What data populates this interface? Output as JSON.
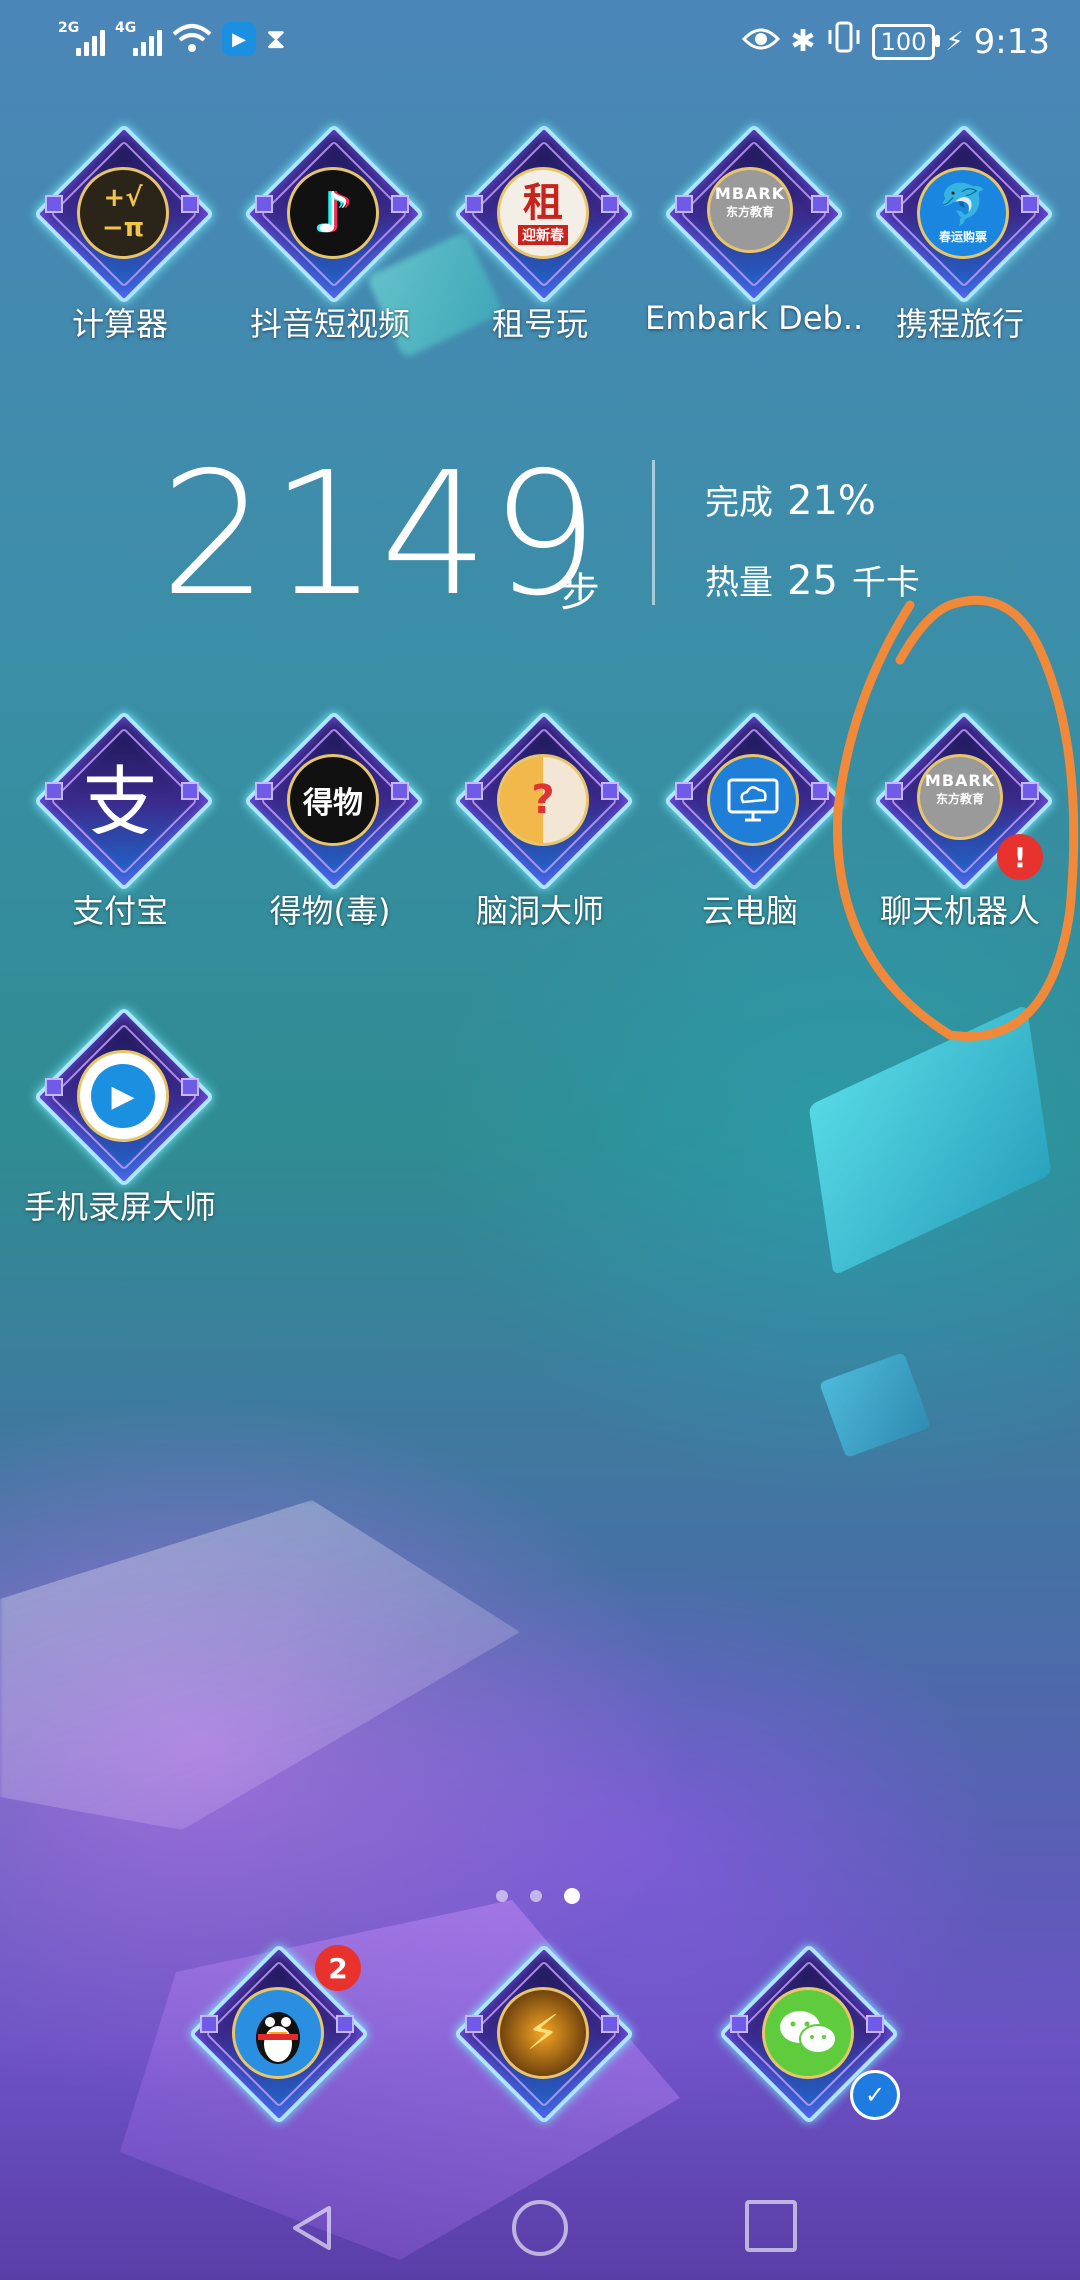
{
  "status_bar": {
    "sim1": "2G",
    "sim2": "4G",
    "time": "9:13",
    "battery": "100",
    "icons": [
      "signal-icon",
      "wifi-icon",
      "screen-record-icon",
      "hourglass-icon",
      "eye-icon",
      "bluetooth-icon",
      "vibrate-icon",
      "charging-icon"
    ]
  },
  "row1": [
    {
      "label": "计算器",
      "icon": "calculator-icon"
    },
    {
      "label": "抖音短视频",
      "icon": "tiktok-icon"
    },
    {
      "label": "租号玩",
      "icon": "zuhaowan-icon",
      "logo_text": "租",
      "logo_sub": "迎新春"
    },
    {
      "label": "Embark Deb..",
      "icon": "embark-icon",
      "logo_text": "MBARK",
      "logo_sub": "东方教育"
    },
    {
      "label": "携程旅行",
      "icon": "ctrip-icon",
      "logo_sub": "春运购票"
    }
  ],
  "step_widget": {
    "steps": "2149",
    "unit": "步",
    "done_label": "完成",
    "done_value": "21%",
    "calorie_label": "热量",
    "calorie_value": "25",
    "calorie_unit": "千卡"
  },
  "row2": [
    {
      "label": "支付宝",
      "icon": "alipay-icon",
      "logo_text": "支"
    },
    {
      "label": "得物(毒)",
      "icon": "dewu-icon",
      "logo_text": "得物"
    },
    {
      "label": "脑洞大师",
      "icon": "brain-icon"
    },
    {
      "label": "云电脑",
      "icon": "cloud-pc-icon"
    },
    {
      "label": "聊天机器人",
      "icon": "chatbot-icon",
      "logo_text": "MBARK",
      "logo_sub": "东方教育",
      "badge": "!"
    }
  ],
  "row3": [
    {
      "label": "手机录屏大师",
      "icon": "screen-recorder-icon"
    }
  ],
  "page_indicator": {
    "count": 3,
    "active": 3
  },
  "dock": [
    {
      "name": "qq",
      "icon": "qq-icon",
      "badge": "2"
    },
    {
      "name": "game",
      "icon": "lightning-game-icon"
    },
    {
      "name": "wechat",
      "icon": "wechat-icon"
    }
  ],
  "nav": [
    "back-icon",
    "home-icon",
    "recent-apps-icon"
  ]
}
